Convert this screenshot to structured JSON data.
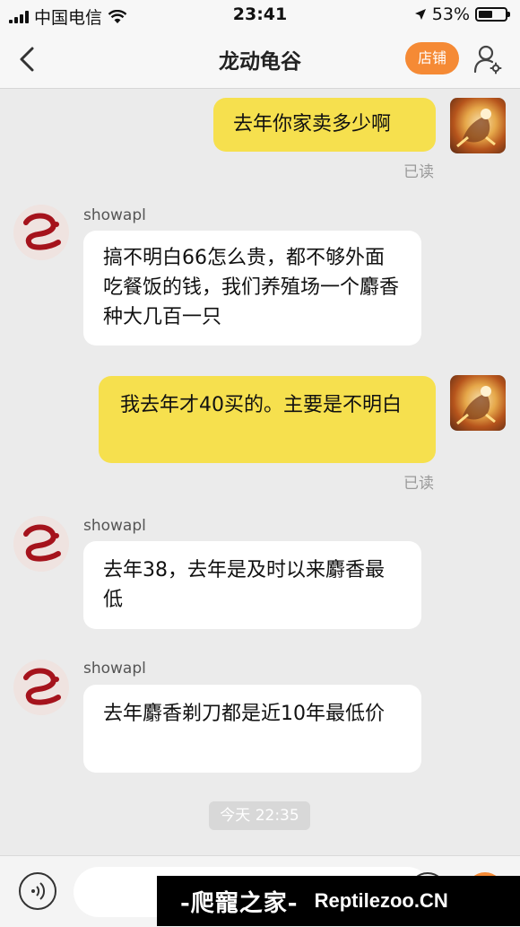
{
  "status_bar": {
    "carrier": "中国电信",
    "time": "23:41",
    "battery": "53%",
    "battery_level": 0.53
  },
  "nav": {
    "title": "龙动龟谷",
    "store_label": "店铺"
  },
  "messages": [
    {
      "from": "self",
      "text": "去年你家卖多少啊",
      "status": "已读"
    },
    {
      "from": "shop",
      "sender": "showapl",
      "text": "搞不明白66怎么贵，都不够外面吃餐饭的钱，我们养殖场一个麝香种大几百一只"
    },
    {
      "from": "self",
      "text": "我去年才40买的。主要是不明白",
      "status": "已读"
    },
    {
      "from": "shop",
      "sender": "showapl",
      "text": "去年38，去年是及时以来麝香最低"
    },
    {
      "from": "shop",
      "sender": "showapl",
      "text": "去年麝香剃刀都是近10年最低价"
    }
  ],
  "time_divider": "今天 22:35",
  "input": {
    "placeholder": ""
  },
  "watermark": {
    "cn": "-爬寵之家-",
    "en": "Reptilezoo.CN"
  },
  "colors": {
    "accent": "#f58a35",
    "self_bubble": "#f6e04e",
    "background": "#ebebeb"
  }
}
